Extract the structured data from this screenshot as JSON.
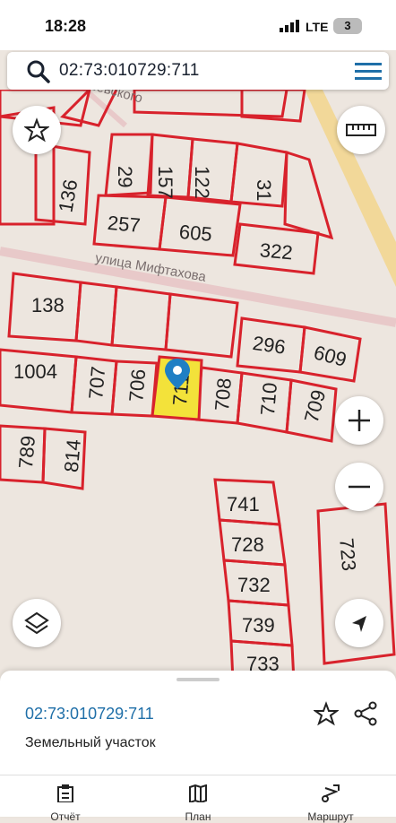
{
  "status_bar": {
    "time": "18:28",
    "network": "LTE",
    "battery": "3"
  },
  "search": {
    "query": "02:73:010729:711"
  },
  "map": {
    "streets": [
      "ул. Чернышевского",
      "улица Мифтахова"
    ],
    "parcels": [
      "29",
      "157",
      "122",
      "31",
      "136",
      "257",
      "605",
      "322",
      "138",
      "296",
      "609",
      "1004",
      "707",
      "706",
      "711",
      "708",
      "710",
      "709",
      "789",
      "814",
      "741",
      "728",
      "732",
      "739",
      "733",
      "723"
    ],
    "selected_parcel": "711"
  },
  "info": {
    "cadastral_number": "02:73:010729:711",
    "type": "Земельный участок"
  },
  "tabs": [
    {
      "label": "Отчёт"
    },
    {
      "label": "План"
    },
    {
      "label": "Маршрут"
    }
  ],
  "colors": {
    "parcel": "#d8222c",
    "selected_fill": "#f3e23a",
    "link": "#1f6fa8",
    "marker": "#1f7fc4"
  }
}
